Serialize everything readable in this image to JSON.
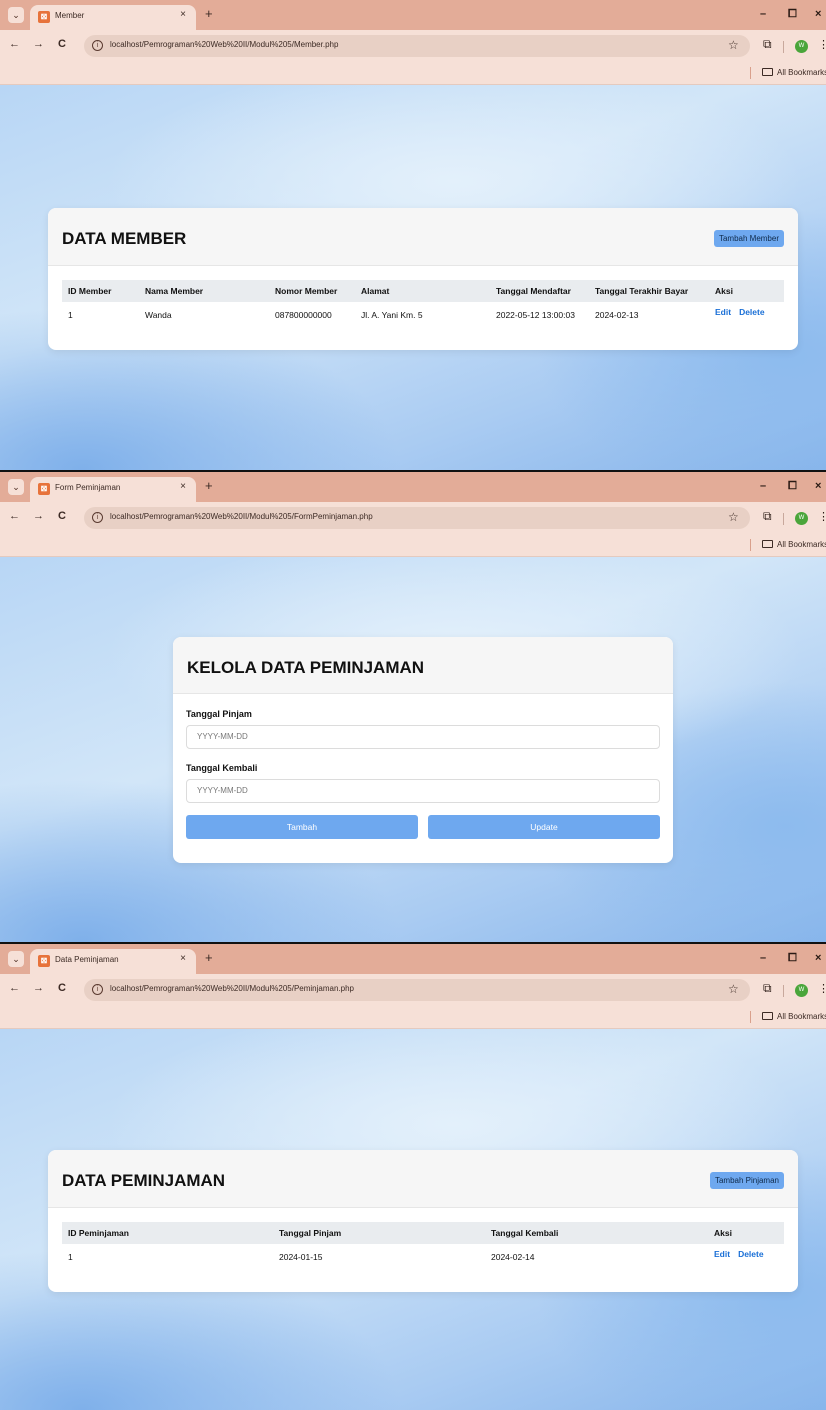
{
  "browser": {
    "new_tab": "+",
    "tab_close": "×",
    "tab_drop": "⌄",
    "back": "←",
    "forward": "→",
    "reload": "C",
    "info_icon": "i",
    "star": "☆",
    "extensions": "⧉",
    "avatar_letter": "W",
    "menu": "⋮",
    "minimize": "–",
    "restore": "⧠",
    "close": "×",
    "bookmarks_label": "All Bookmarks"
  },
  "screens": [
    {
      "tab_title": "Member",
      "url": "localhost/Pemrograman%20Web%20II/Modul%205/Member.php"
    },
    {
      "tab_title": "Form Peminjaman",
      "url": "localhost/Pemrograman%20Web%20II/Modul%205/FormPeminjaman.php"
    },
    {
      "tab_title": "Data Peminjaman",
      "url": "localhost/Pemrograman%20Web%20II/Modul%205/Peminjaman.php"
    }
  ],
  "member": {
    "title": "DATA MEMBER",
    "add_button": "Tambah Member",
    "headers": [
      "ID Member",
      "Nama Member",
      "Nomor Member",
      "Alamat",
      "Tanggal Mendaftar",
      "Tanggal Terakhir Bayar",
      "Aksi"
    ],
    "rows": [
      {
        "id": "1",
        "nama": "Wanda",
        "nomor": "087800000000",
        "alamat": "Jl. A. Yani Km. 5",
        "mendaftar": "2022-05-12 13:00:03",
        "bayar": "2024-02-13",
        "edit": "Edit",
        "delete": "Delete"
      }
    ]
  },
  "form": {
    "title": "KELOLA DATA PEMINJAMAN",
    "label_pinjam": "Tanggal Pinjam",
    "placeholder_pinjam": "YYYY-MM-DD",
    "label_kembali": "Tanggal Kembali",
    "placeholder_kembali": "YYYY-MM-DD",
    "btn_tambah": "Tambah",
    "btn_update": "Update"
  },
  "peminjaman": {
    "title": "DATA PEMINJAMAN",
    "add_button": "Tambah Pinjaman",
    "headers": [
      "ID Peminjaman",
      "Tanggal Pinjam",
      "Tanggal Kembali",
      "Aksi"
    ],
    "rows": [
      {
        "id": "1",
        "pinjam": "2024-01-15",
        "kembali": "2024-02-14",
        "edit": "Edit",
        "delete": "Delete"
      }
    ]
  }
}
